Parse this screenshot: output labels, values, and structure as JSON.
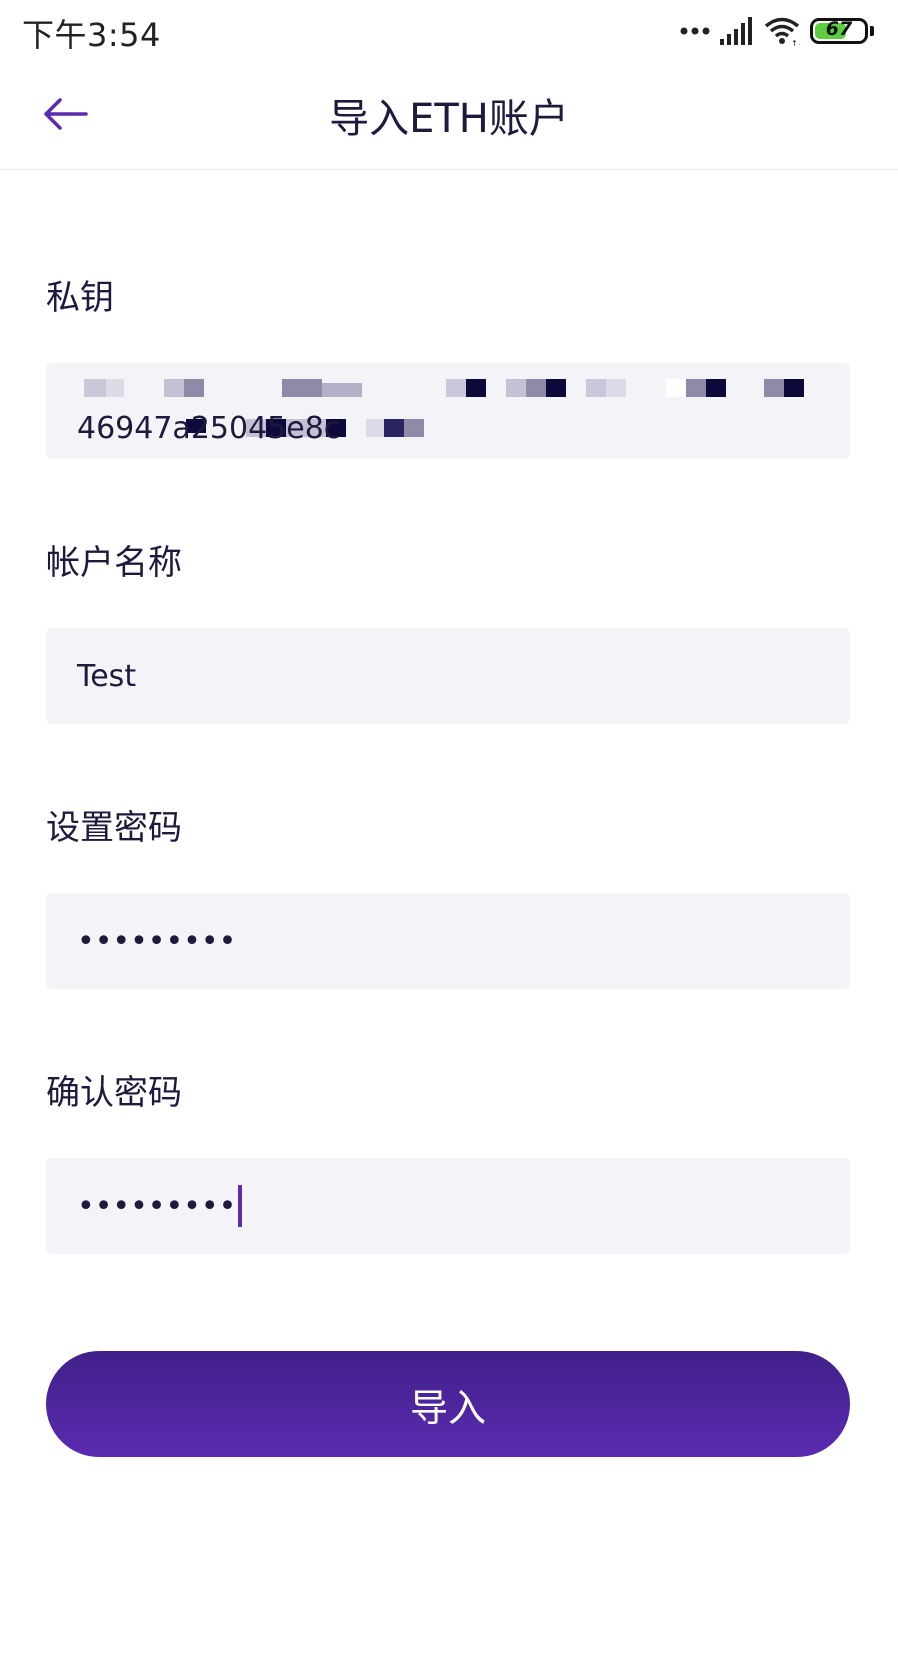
{
  "status_bar": {
    "time": "下午3:54",
    "battery": "67",
    "battery_fraction": 0.67,
    "icons": [
      "more-dots-icon",
      "signal-icon",
      "wifi-icon",
      "battery-icon"
    ]
  },
  "header": {
    "back_icon": "arrow-left-icon",
    "title": "导入ETH账户"
  },
  "form": {
    "private_key": {
      "label": "私钥",
      "value_visible": "46947a25045e8c"
    },
    "account_name": {
      "label": "帐户名称",
      "value": "Test"
    },
    "password": {
      "label": "设置密码",
      "value": "•••••••••"
    },
    "confirm_password": {
      "label": "确认密码",
      "value": "•••••••••"
    }
  },
  "actions": {
    "import_label": "导入"
  },
  "colors": {
    "accent": "#5a2bb0",
    "button_top": "#41208a",
    "text": "#1e1a3d",
    "field_bg": "#f3f4f8",
    "battery_fill": "#5dcf3e"
  }
}
